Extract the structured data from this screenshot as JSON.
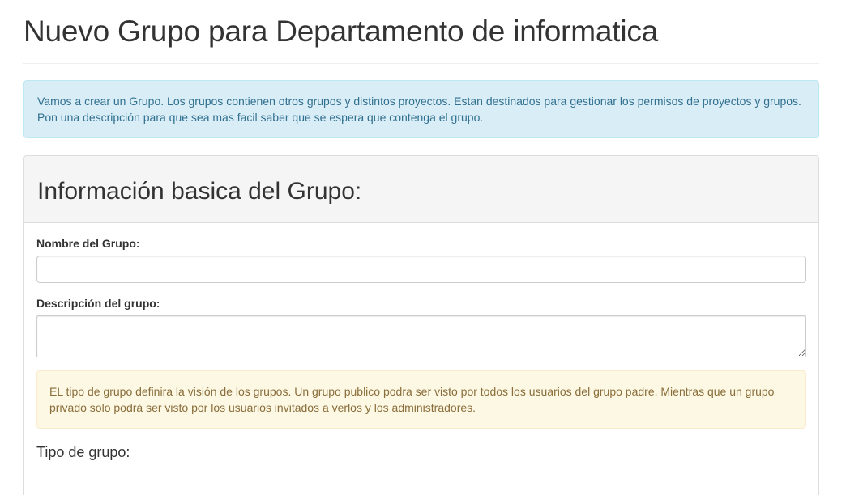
{
  "page": {
    "title": "Nuevo Grupo para Departamento de informatica"
  },
  "info_alert": {
    "text": "Vamos a crear un Grupo. Los grupos contienen otros grupos y distintos proyectos. Estan destinados para gestionar los permisos de proyectos y grupos. Pon una descripción para que sea mas facil saber que se espera que contenga el grupo."
  },
  "panel": {
    "title": "Información basica del Grupo:"
  },
  "form": {
    "name_label": "Nombre del Grupo:",
    "name_value": "",
    "description_label": "Descripción del grupo:",
    "description_value": ""
  },
  "warning_alert": {
    "text": "EL tipo de grupo definira la visión de los grupos. Un grupo publico podra ser visto por todos los usuarios del grupo padre. Mientras que un grupo privado solo podrá ser visto por los usuarios invitados a verlos y los administradores."
  },
  "group_type": {
    "label": "Tipo de grupo:"
  },
  "colors": {
    "info_bg": "#d9edf7",
    "info_text": "#31708f",
    "warning_bg": "#fcf8e3",
    "warning_text": "#8a6d3b"
  }
}
